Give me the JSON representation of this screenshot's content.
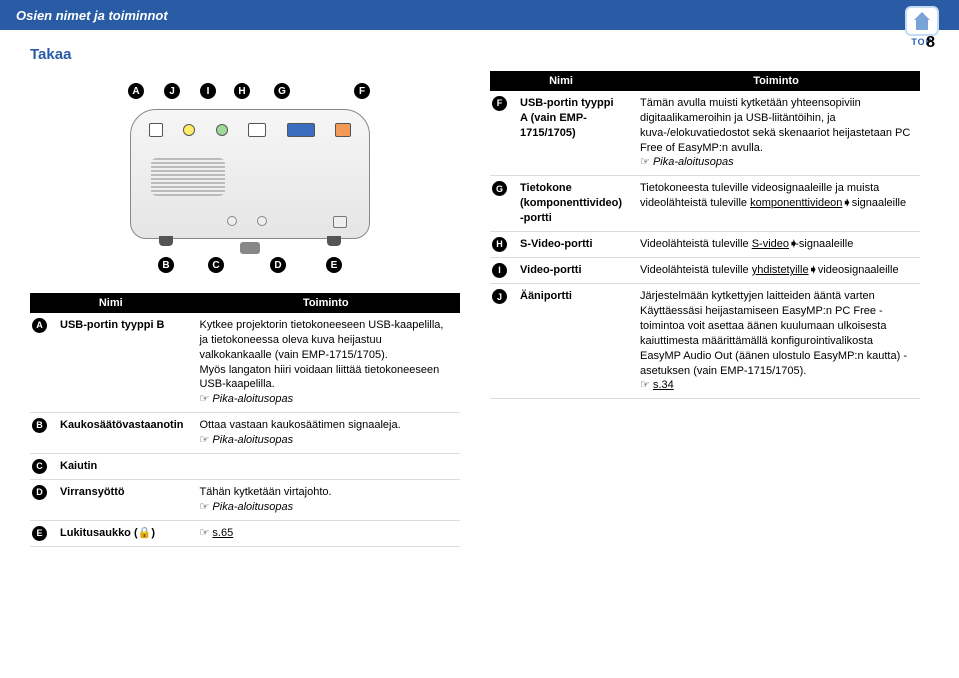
{
  "header": {
    "title": "Osien nimet ja toiminnot",
    "top_label": "TOP",
    "page_num": "8"
  },
  "back": {
    "section_title": "Takaa",
    "th_name": "Nimi",
    "th_func": "Toiminto",
    "callouts": {
      "c1": "A",
      "c2": "B",
      "c3": "C",
      "c4": "D",
      "c5": "E",
      "c6": "F",
      "c7": "G",
      "c8": "H",
      "c9": "I",
      "c10": "J"
    },
    "callout_ids": {
      "r1": "A",
      "r2": "B",
      "r3": "C",
      "r4": "D",
      "r5": "E",
      "r6": "F",
      "r7": "G",
      "r8": "H",
      "r9": "I",
      "r10": "J"
    },
    "left_rows": {
      "r1": {
        "name": "USB-portin tyyppi B",
        "desc_a": "Kytkee projektorin tietokoneeseen USB-kaapelilla, ja tietokoneessa oleva kuva heijastuu valkokankaalle (vain EMP-1715/1705).",
        "desc_b": "Myös langaton hiiri voidaan liittää tietokoneeseen USB-kaapelilla.",
        "guide": "Pika-aloitusopas"
      },
      "r2": {
        "name": "Kaukosäätövastaanotin",
        "desc_a": "Ottaa vastaan kaukosäätimen signaaleja.",
        "guide": "Pika-aloitusopas"
      },
      "r3": {
        "name": "Kaiutin"
      },
      "r4": {
        "name": "Virransyöttö",
        "desc_a": "Tähän kytketään virtajohto.",
        "guide": "Pika-aloitusopas"
      },
      "r5": {
        "name": "Lukitusaukko (🔒)",
        "link": "s.65"
      }
    },
    "right_rows": {
      "r6": {
        "name": "USB-portin tyyppi A (vain EMP-1715/1705)",
        "desc_a": "Tämän avulla muisti kytketään yhteensopiviin digitaalikameroihin ja USB-liitäntöihin, ja kuva-/elokuvatiedostot sekä skenaariot heijastetaan PC Free of EasyMP:n avulla.",
        "guide": "Pika-aloitusopas"
      },
      "r7": {
        "name": "Tietokone (komponenttivideo) -portti",
        "desc_a": "Tietokoneesta tuleville videosignaaleille ja muista videolähteistä tuleville ",
        "link_word": "komponenttivideon",
        "desc_b": " signaaleille"
      },
      "r8": {
        "name": "S-Video-portti",
        "desc_a": "Videolähteistä tuleville ",
        "link_word": "S-video",
        "desc_b": "-signaaleille"
      },
      "r9": {
        "name": "Video-portti",
        "desc_a": "Videolähteistä tuleville ",
        "link_word": "yhdistetyille",
        "desc_b": " videosignaaleille"
      },
      "r10": {
        "name": "Ääniportti",
        "desc_a": "Järjestelmään kytkettyjen laitteiden ääntä varten",
        "desc_b": "Käyttäessäsi heijastamiseen EasyMP:n PC Free -toimintoa voit asettaa äänen kuulumaan ulkoisesta kaiuttimesta määrittämällä konfigurointivalikosta EasyMP Audio Out (äänen ulostulo EasyMP:n kautta) -asetuksen (vain EMP-1715/1705).",
        "link": "s.34"
      }
    }
  }
}
